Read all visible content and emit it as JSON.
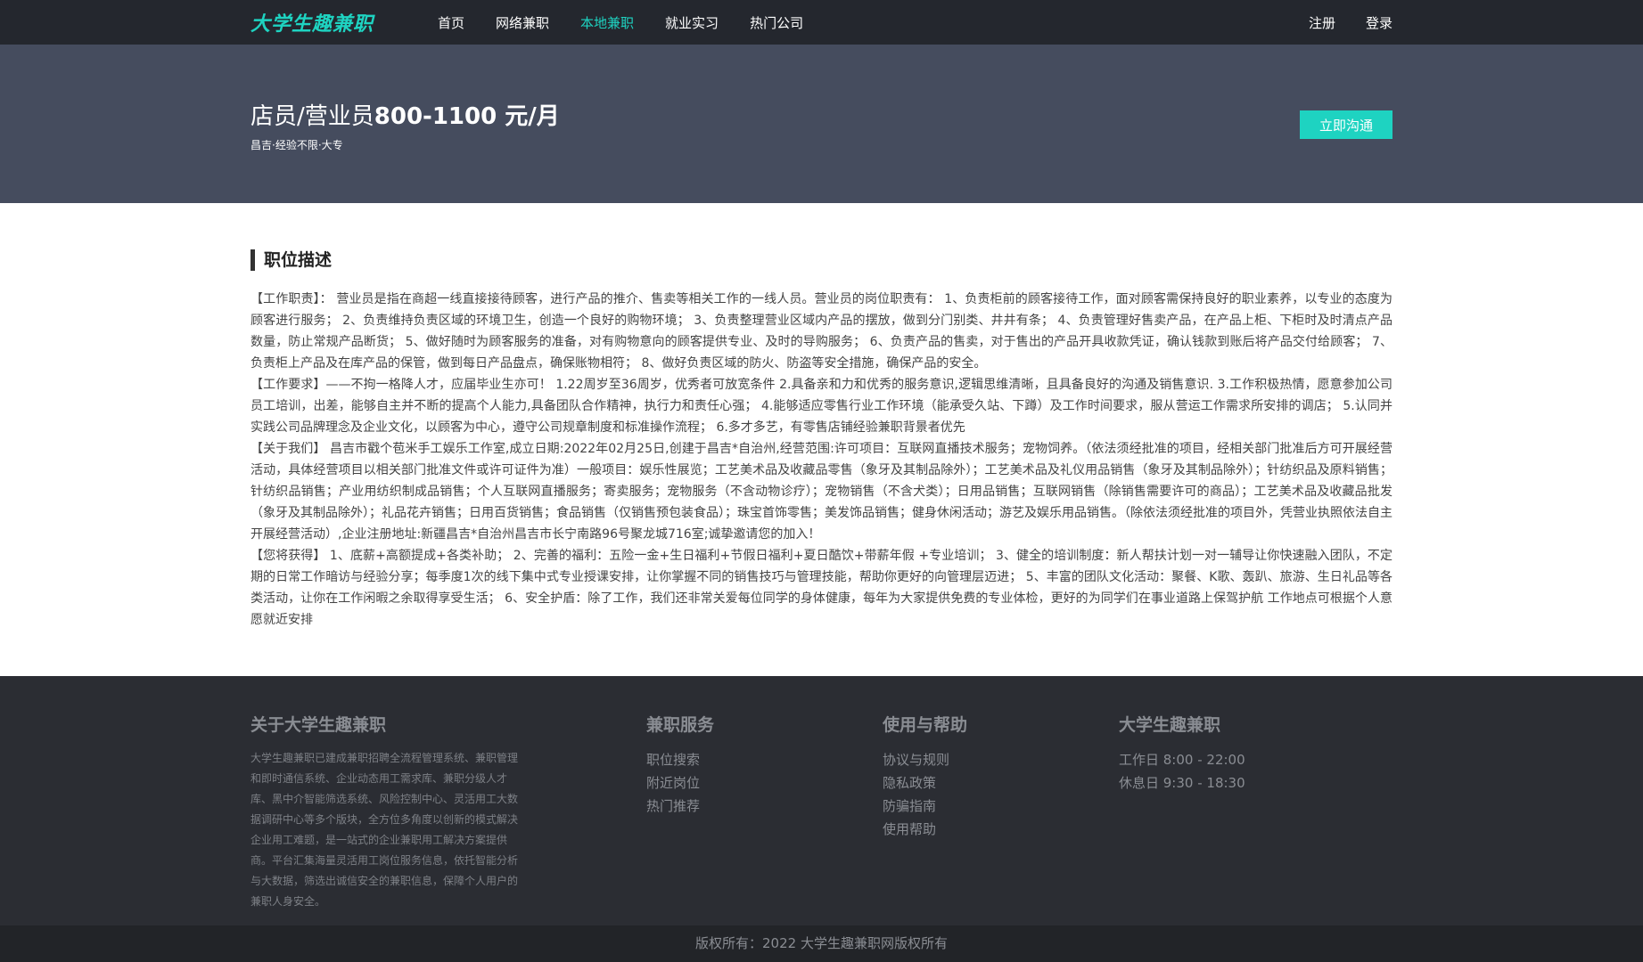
{
  "nav": {
    "logo": "大学生趣兼职",
    "links": [
      "首页",
      "网络兼职",
      "本地兼职",
      "就业实习",
      "热门公司"
    ],
    "active_index": 2,
    "register": "注册",
    "login": "登录"
  },
  "hero": {
    "title": "店员/营业员",
    "salary": "800-1100 元/月",
    "meta": "昌吉·经验不限·大专",
    "chat_button": "立即沟通"
  },
  "description": {
    "heading": "职位描述",
    "paragraphs": [
      "【工作职责】： 营业员是指在商超一线直接接待顾客，进行产品的推介、售卖等相关工作的一线人员。营业员的岗位职责有： 1、负责柜前的顾客接待工作，面对顾客需保持良好的职业素养，以专业的态度为顾客进行服务； 2、负责维持负责区域的环境卫生，创造一个良好的购物环境； 3、负责整理营业区域内产品的摆放，做到分门别类、井井有条； 4、负责管理好售卖产品，在产品上柜、下柜时及时清点产品数量，防止常规产品断货； 5、做好随时为顾客服务的准备，对有购物意向的顾客提供专业、及时的导购服务； 6、负责产品的售卖，对于售出的产品开具收款凭证，确认钱款到账后将产品交付给顾客； 7、负责柜上产品及在库产品的保管，做到每日产品盘点，确保账物相符； 8、做好负责区域的防火、防盗等安全措施，确保产品的安全。",
      "【工作要求】——不拘一格降人才，应届毕业生亦可！ 1.22周岁至36周岁，优秀者可放宽条件 2.具备亲和力和优秀的服务意识,逻辑思维清晰，且具备良好的沟通及销售意识. 3.工作积极热情，愿意参加公司员工培训，出差，能够自主并不断的提高个人能力,具备团队合作精神，执行力和责任心强； 4.能够适应零售行业工作环境（能承受久站、下蹲）及工作时间要求，服从营运工作需求所安排的调店； 5.认同并实践公司品牌理念及企业文化，以顾客为中心，遵守公司规章制度和标准操作流程； 6.多才多艺，有零售店铺经验兼职背景者优先",
      "【关于我们】 昌吉市戳个苞米手工娱乐工作室,成立日期:2022年02月25日,创建于昌吉*自治州,经营范围:许可项目：互联网直播技术服务；宠物饲养。（依法须经批准的项目，经相关部门批准后方可开展经营活动，具体经营项目以相关部门批准文件或许可证件为准）一般项目：娱乐性展览；工艺美术品及收藏品零售（象牙及其制品除外）；工艺美术品及礼仪用品销售（象牙及其制品除外）；针纺织品及原料销售；针纺织品销售；产业用纺织制成品销售；个人互联网直播服务；寄卖服务；宠物服务（不含动物诊疗）；宠物销售（不含犬类）；日用品销售；互联网销售（除销售需要许可的商品）；工艺美术品及收藏品批发（象牙及其制品除外）；礼品花卉销售；日用百货销售；食品销售（仅销售预包装食品）；珠宝首饰零售；美发饰品销售；健身休闲活动；游艺及娱乐用品销售。（除依法须经批准的项目外，凭营业执照依法自主开展经营活动）,企业注册地址:新疆昌吉*自治州昌吉市长宁南路96号聚龙城716室;诚挚邀请您的加入！",
      "【您将获得】 1、底薪+高额提成+各类补助； 2、完善的福利：五险一金+生日福利+节假日福利+夏日酷饮+带薪年假 +专业培训； 3、健全的培训制度：新人帮扶计划一对一辅导让你快速融入团队，不定期的日常工作暗访与经验分享；每季度1次的线下集中式专业授课安排，让你掌握不同的销售技巧与管理技能，帮助你更好的向管理层迈进； 5、丰富的团队文化活动：聚餐、K歌、轰趴、旅游、生日礼品等各类活动，让你在工作闲暇之余取得享受生活； 6、安全护盾：除了工作，我们还非常关爱每位同学的身体健康，每年为大家提供免费的专业体检，更好的为同学们在事业道路上保驾护航 工作地点可根据个人意愿就近安排"
    ]
  },
  "footer": {
    "about_title": "关于大学生趣兼职",
    "about_text": "大学生趣兼职已建成兼职招聘全流程管理系统、兼职管理和即时通信系统、企业动态用工需求库、兼职分级人才库、黑中介智能筛选系统、风险控制中心、灵活用工大数据调研中心等多个版块，全方位多角度以创新的模式解决企业用工难题，是一站式的企业兼职用工解决方案提供商。平台汇集海量灵活用工岗位服务信息，依托智能分析与大数据，筛选出诚信安全的兼职信息，保障个人用户的兼职人身安全。",
    "services_title": "兼职服务",
    "services": [
      "职位搜索",
      "附近岗位",
      "热门推荐"
    ],
    "help_title": "使用与帮助",
    "help": [
      "协议与规则",
      "隐私政策",
      "防骗指南",
      "使用帮助"
    ],
    "contact_title": "大学生趣兼职",
    "hours": [
      "工作日 8:00 - 22:00",
      "休息日 9:30 - 18:30"
    ]
  },
  "copyright": "版权所有：2022 大学生趣兼职网版权所有",
  "colors": {
    "accent": "#1ed3c1",
    "nav_bg": "#24272e",
    "hero_bg": "#454c5e",
    "footer_bg": "#2b2d33"
  }
}
